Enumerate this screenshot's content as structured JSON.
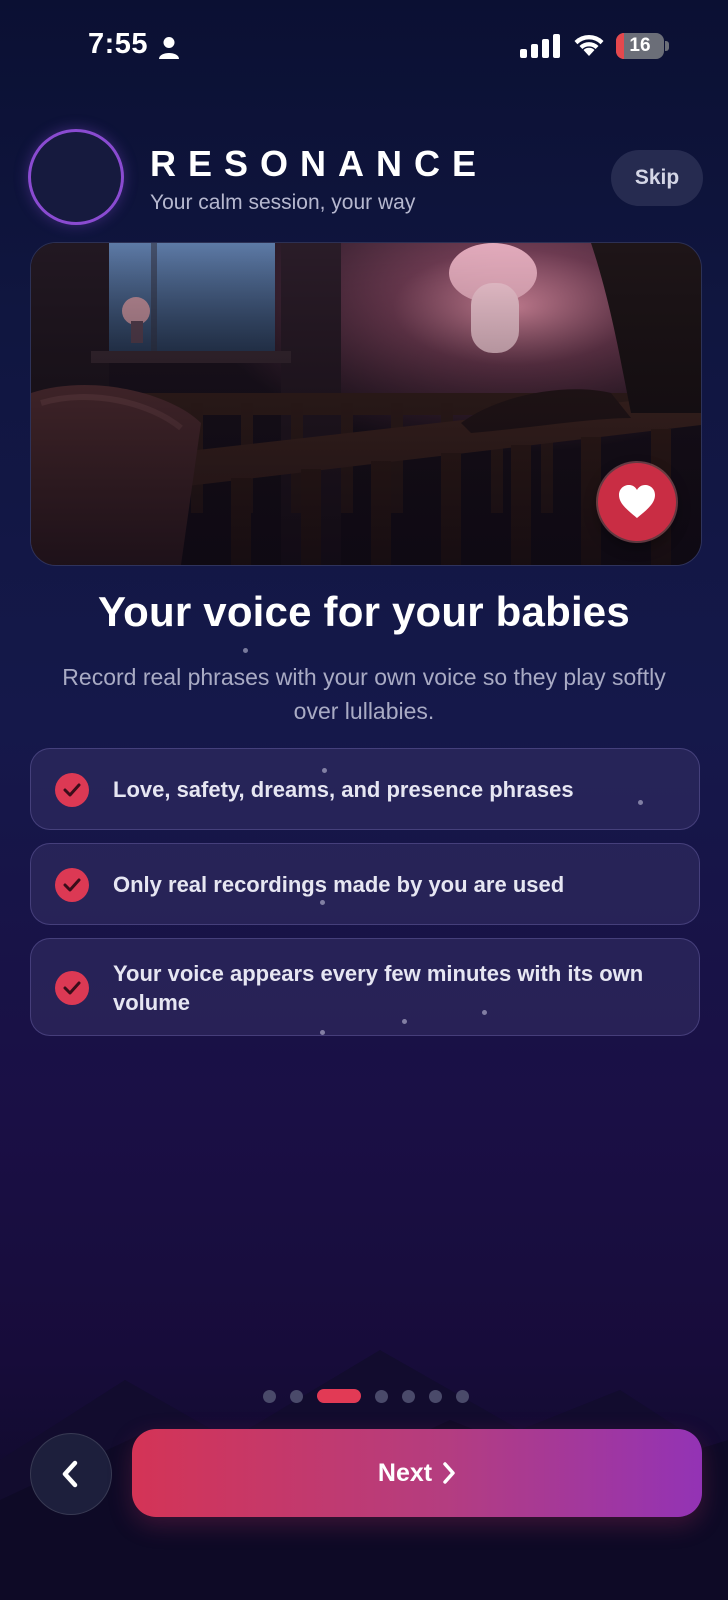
{
  "status_bar": {
    "time": "7:55",
    "battery_level": "16",
    "battery_fraction": 0.16,
    "icons": [
      "person-icon",
      "cellular-signal-icon",
      "wifi-icon",
      "battery-icon"
    ]
  },
  "header": {
    "brand": "RESONANCE",
    "tagline": "Your calm session, your way",
    "skip_label": "Skip",
    "logo_icon": "sound-wave-icon"
  },
  "hero": {
    "image": "nursery-crib-photo",
    "favorite_icon": "heart-icon"
  },
  "content": {
    "title": "Your voice for your babies",
    "description": "Record real phrases with your own voice so they play softly over lullabies."
  },
  "features": [
    {
      "text": "Love, safety, dreams, and presence phrases",
      "icon": "check-icon"
    },
    {
      "text": "Only real recordings made by you are used",
      "icon": "check-icon"
    },
    {
      "text": "Your voice appears every few minutes with its own volume",
      "icon": "check-icon"
    }
  ],
  "pager": {
    "total": 7,
    "current": 3
  },
  "footer": {
    "back_icon": "chevron-left-icon",
    "next_label": "Next",
    "next_icon": "chevron-right-icon"
  },
  "colors": {
    "accent": "#e23a55",
    "gradient_start": "#d43456",
    "gradient_end": "#9333b5",
    "background": "#101640"
  }
}
